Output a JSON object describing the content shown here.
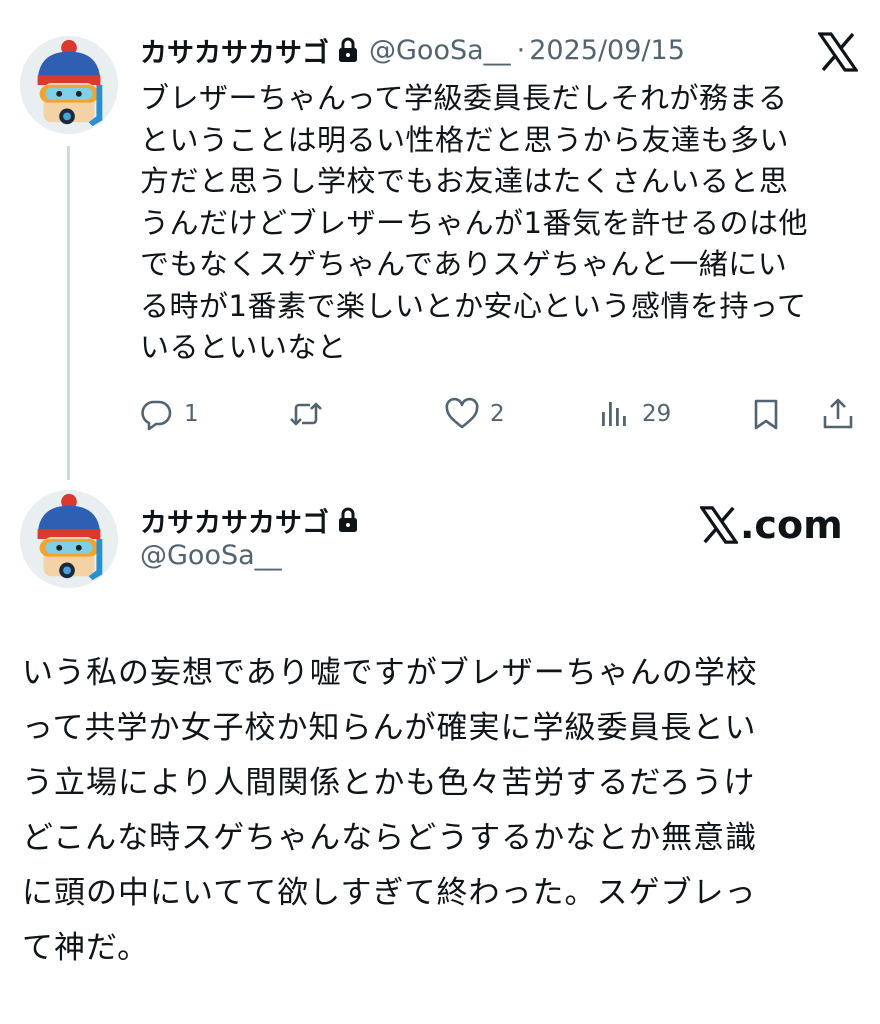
{
  "tweet": {
    "display_name": "カサカサカサゴ",
    "handle": "@GooSa__",
    "separator": "·",
    "date": "2025/09/15",
    "text": "ブレザーちゃんって学級委員長だしそれが務まる\nということは明るい性格だと思うから友達も多い\n方だと思うし学校でもお友達はたくさんいると思\nうんだけどブレザーちゃんが1番気を許せるのは他\nでもなくスゲちゃんでありスゲちゃんと一緒にい\nる時が1番素で楽しいとか安心という感情を持って\nいるといいなと",
    "actions": {
      "replies": "1",
      "reposts": "",
      "likes": "2",
      "views": "29"
    }
  },
  "card_footer": {
    "display_name": "カサカサカサゴ",
    "handle": "@GooSa__",
    "domain": ".com"
  },
  "continuation_text": "いう私の妄想であり嘘ですがブレザーちゃんの学校\nって共学か女子校か知らんが確実に学級委員長とい\nう立場により人間関係とかも色々苦労するだろうけ\nどこんな時スゲちゃんならどうするかなとか無意識\nに頭の中にいてて欲しすぎて終わった。スゲブレっ\nて神だ。",
  "icons": {
    "top_right": "x-logo-icon",
    "lock": "lock-icon",
    "reply": "reply-icon",
    "repost": "repost-icon",
    "like": "heart-icon",
    "views": "views-chart-icon",
    "bookmark": "bookmark-icon",
    "share": "share-icon"
  },
  "colors": {
    "text": "#0f1419",
    "muted": "#536471",
    "thread_line": "#cfd9de"
  }
}
